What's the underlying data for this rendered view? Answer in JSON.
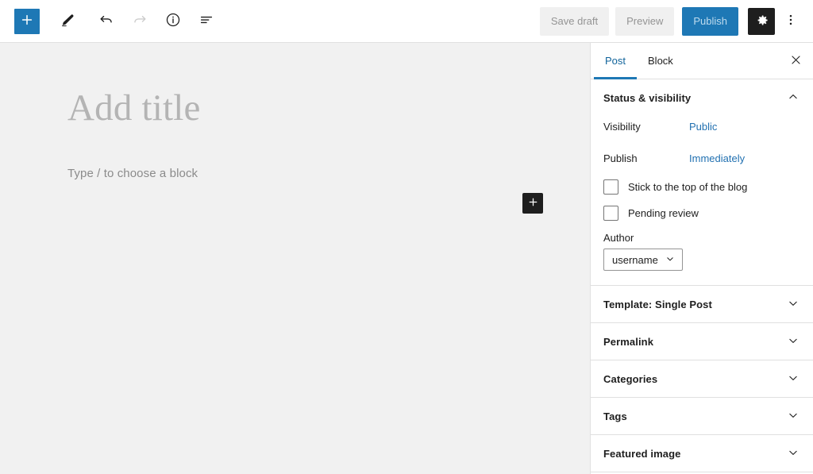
{
  "header": {
    "left_tools": [
      {
        "name": "block-inserter-toggle",
        "icon": "plus-icon",
        "label": "Add block"
      },
      {
        "name": "edit-mode-pencil",
        "icon": "pencil-icon",
        "label": "Edit"
      },
      {
        "name": "undo-button",
        "icon": "undo-icon",
        "label": "Undo",
        "state": "enabled"
      },
      {
        "name": "redo-button",
        "icon": "redo-icon",
        "label": "Redo",
        "state": "disabled"
      },
      {
        "name": "details-button",
        "icon": "info-icon",
        "label": "Details"
      },
      {
        "name": "list-view-button",
        "icon": "list-view-icon",
        "label": "List view"
      }
    ],
    "save_draft_label": "Save draft",
    "preview_label": "Preview",
    "publish_label": "Publish",
    "settings_icon": "gear-icon",
    "settings_label": "Settings",
    "more_menu_icon": "kebab-menu-icon",
    "more_menu_label": "Options"
  },
  "canvas": {
    "title_placeholder": "Add title",
    "block_placeholder": "Type / to choose a block",
    "inserter_icon": "plus-icon",
    "inserter_label": "Add block"
  },
  "sidebar": {
    "tabs": [
      {
        "label": "Post",
        "active": true
      },
      {
        "label": "Block",
        "active": false
      }
    ],
    "close_icon": "close-icon",
    "close_label": "Close settings",
    "panels": [
      {
        "title": "Status & visibility",
        "expanded": true,
        "chevron": "chevron-up-icon",
        "rows": [
          {
            "label": "Visibility",
            "value": "Public"
          },
          {
            "label": "Publish",
            "value": "Immediately"
          }
        ],
        "checkboxes": [
          {
            "label": "Stick to the top of the blog",
            "checked": false
          },
          {
            "label": "Pending review",
            "checked": false
          }
        ],
        "author_label": "Author",
        "author_value": "username"
      },
      {
        "title": "Template: Single Post",
        "expanded": false,
        "chevron": "chevron-down-icon"
      },
      {
        "title": "Permalink",
        "expanded": false,
        "chevron": "chevron-down-icon"
      },
      {
        "title": "Categories",
        "expanded": false,
        "chevron": "chevron-down-icon"
      },
      {
        "title": "Tags",
        "expanded": false,
        "chevron": "chevron-down-icon"
      },
      {
        "title": "Featured image",
        "expanded": false,
        "chevron": "chevron-down-icon"
      }
    ]
  },
  "colors": {
    "accent_blue": "#1e78b5",
    "link_blue": "#2271b1",
    "canvas_bg": "#f1f1f1",
    "panel_bg": "#ffffff",
    "border": "#e0e0e0",
    "dark": "#1e1e1e",
    "muted_text": "#949494",
    "placeholder_title": "#b4b4b4"
  }
}
